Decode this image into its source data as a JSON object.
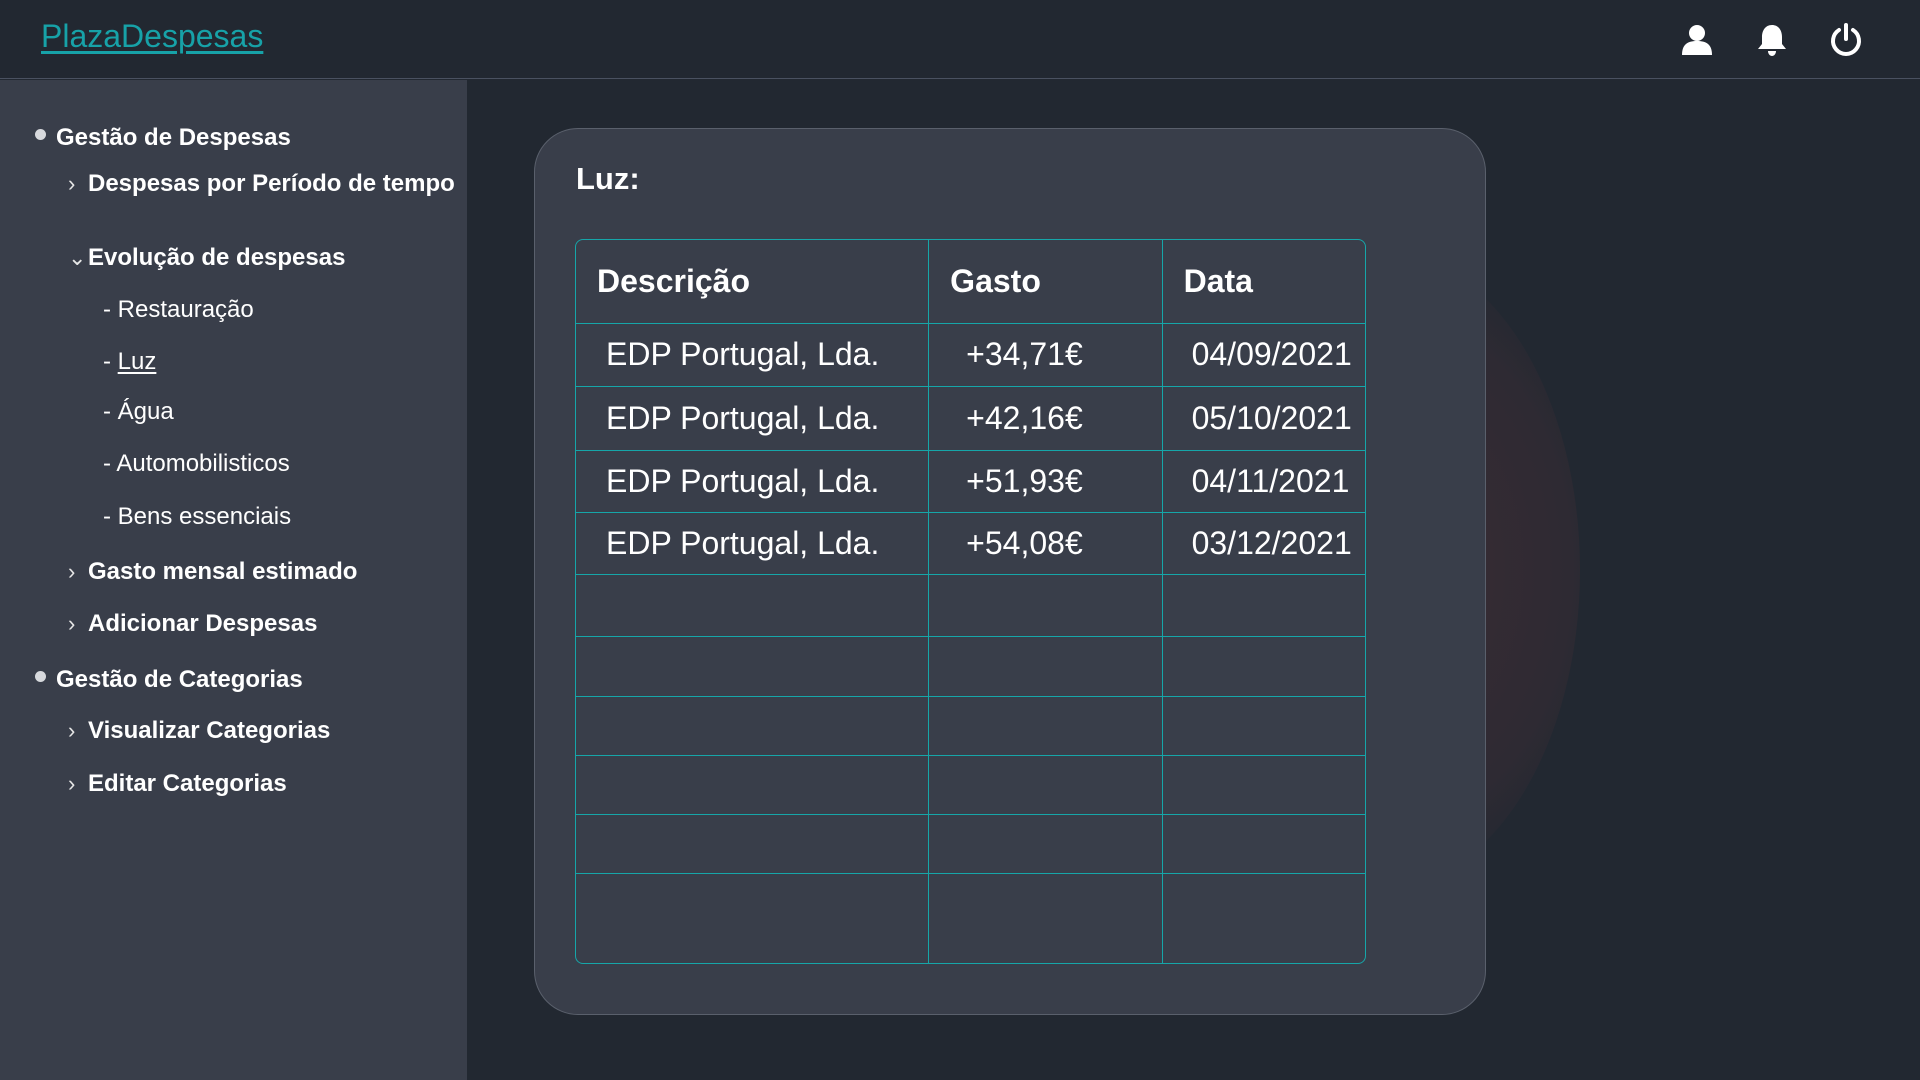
{
  "app": {
    "brand": "PlazaDespesas",
    "accent_color": "#17a2a8",
    "header_icons": [
      "user-icon",
      "bell-icon",
      "power-icon"
    ]
  },
  "sidebar": {
    "sections": [
      {
        "label": "Gestão de Despesas",
        "items": [
          {
            "label": "Despesas por Período de tempo"
          },
          {
            "label": "Evolução de despesas",
            "children": [
              "- Restauração",
              "- ",
              "Luz",
              "- Água",
              "- Automobilisticos",
              "- Bens essenciais"
            ]
          },
          {
            "label": "Gasto mensal estimado"
          },
          {
            "label": "Adicionar Despesas"
          }
        ]
      },
      {
        "label": "Gestão de Categorias",
        "items": [
          {
            "label": "Visualizar Categorias"
          },
          {
            "label": "Editar Categorias"
          }
        ]
      }
    ],
    "active_item": "Luz"
  },
  "main": {
    "card_title": "Luz:",
    "table": {
      "headers": [
        "Descrição",
        "Gasto",
        "Data"
      ],
      "rows": [
        [
          "EDP Portugal, Lda.",
          "+34,71€",
          "04/09/2021"
        ],
        [
          "EDP Portugal, Lda.",
          "+42,16€",
          "05/10/2021"
        ],
        [
          "EDP Portugal, Lda.",
          "+51,93€",
          "04/11/2021"
        ],
        [
          "EDP Portugal, Lda.",
          "+54,08€",
          "03/12/2021"
        ],
        [
          "",
          "",
          ""
        ],
        [
          "",
          "",
          ""
        ],
        [
          "",
          "",
          ""
        ],
        [
          "",
          "",
          ""
        ],
        [
          "",
          "",
          ""
        ],
        [
          "",
          "",
          ""
        ]
      ]
    }
  }
}
